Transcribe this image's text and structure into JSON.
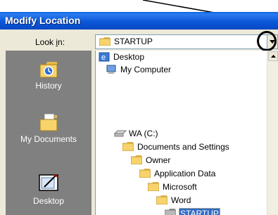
{
  "window": {
    "title": "Modify Location"
  },
  "look_in": {
    "label_prefix": "Look ",
    "label_accel": "i",
    "label_suffix": "n:",
    "value": "STARTUP"
  },
  "places": [
    {
      "label": "History",
      "icon": "history-icon"
    },
    {
      "label": "My Documents",
      "icon": "my-documents-icon"
    },
    {
      "label": "Desktop",
      "icon": "desktop-icon"
    }
  ],
  "tree": {
    "items": [
      {
        "label": "Desktop",
        "icon": "desktop-icon"
      },
      {
        "label": "My Computer",
        "icon": "my-computer-icon"
      },
      {
        "label": "WA (C:)",
        "icon": "drive-icon"
      },
      {
        "label": "Documents and Settings",
        "icon": "folder-icon"
      },
      {
        "label": "Owner",
        "icon": "folder-icon"
      },
      {
        "label": "Application Data",
        "icon": "folder-icon"
      },
      {
        "label": "Microsoft",
        "icon": "folder-icon"
      },
      {
        "label": "Word",
        "icon": "folder-icon"
      },
      {
        "label": "STARTUP",
        "icon": "folder-open-icon",
        "selected": true
      }
    ]
  },
  "colors": {
    "titlebar": "#0b58d8",
    "places_bar": "#808080",
    "selection": "#316ac5",
    "folder": "#f6d36b"
  }
}
